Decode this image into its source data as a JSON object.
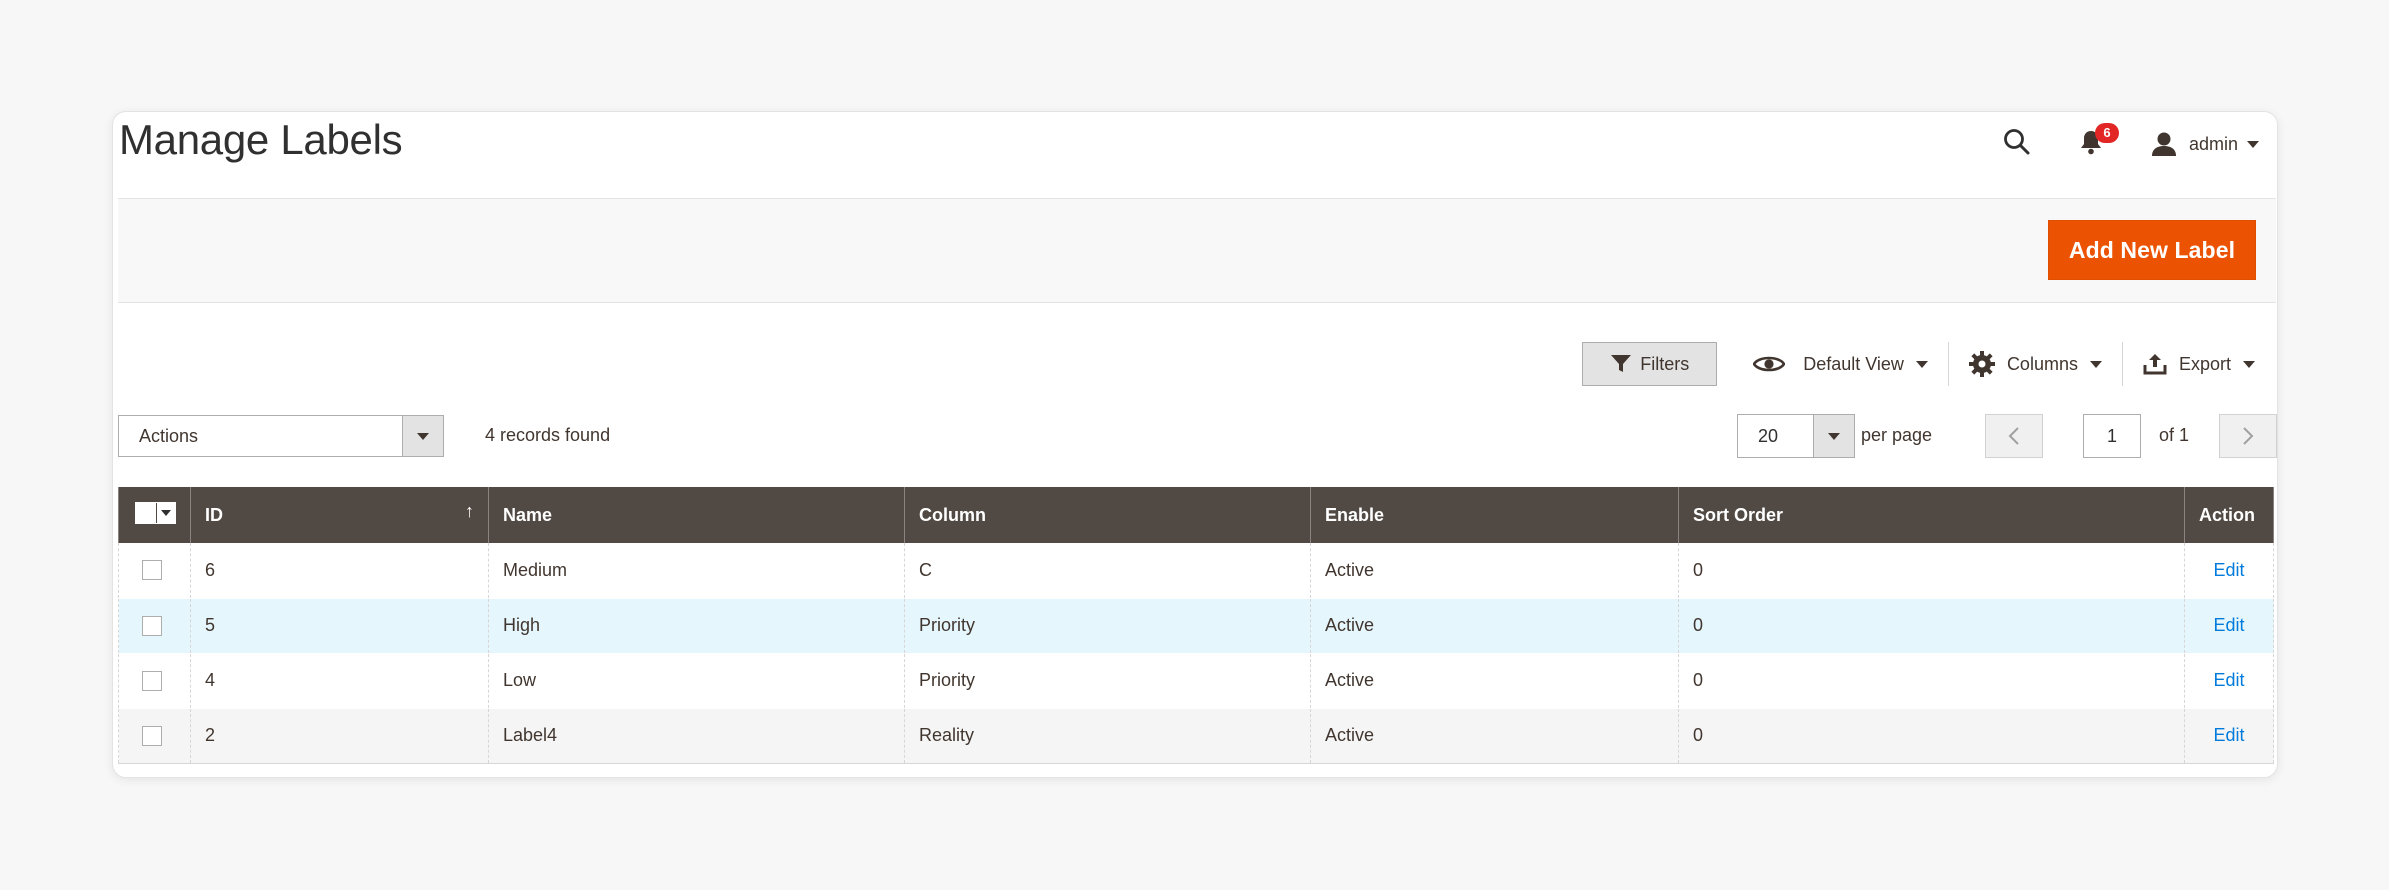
{
  "page": {
    "title": "Manage Labels"
  },
  "header": {
    "notifications_count": "6",
    "user_name": "admin",
    "icons": {
      "search": "search-icon",
      "notifications": "bell-icon",
      "user": "user-icon"
    }
  },
  "action_bar": {
    "add_button_label": "Add New Label"
  },
  "toolbar": {
    "filters_label": "Filters",
    "view_label": "Default View",
    "columns_label": "Columns",
    "export_label": "Export"
  },
  "mass_actions": {
    "select_label": "Actions",
    "records_found": "4 records found"
  },
  "pager": {
    "per_page_value": "20",
    "per_page_label": "per page",
    "current_page": "1",
    "of_pages": "of 1"
  },
  "grid": {
    "columns": [
      "ID",
      "Name",
      "Column",
      "Enable",
      "Sort Order",
      "Action"
    ],
    "rows": [
      {
        "id": "6",
        "name": "Medium",
        "column": "C",
        "enable": "Active",
        "sort_order": "0",
        "action": "Edit"
      },
      {
        "id": "5",
        "name": "High",
        "column": "Priority",
        "enable": "Active",
        "sort_order": "0",
        "action": "Edit"
      },
      {
        "id": "4",
        "name": "Low",
        "column": "Priority",
        "enable": "Active",
        "sort_order": "0",
        "action": "Edit"
      },
      {
        "id": "2",
        "name": "Label4",
        "column": "Reality",
        "enable": "Active",
        "sort_order": "0",
        "action": "Edit"
      }
    ],
    "sort_indicator": "↑"
  },
  "colors": {
    "accent": "#eb5202",
    "header_bg": "#514943",
    "link": "#007bdb",
    "badge": "#e22626",
    "row_highlight": "#e5f6fd"
  }
}
